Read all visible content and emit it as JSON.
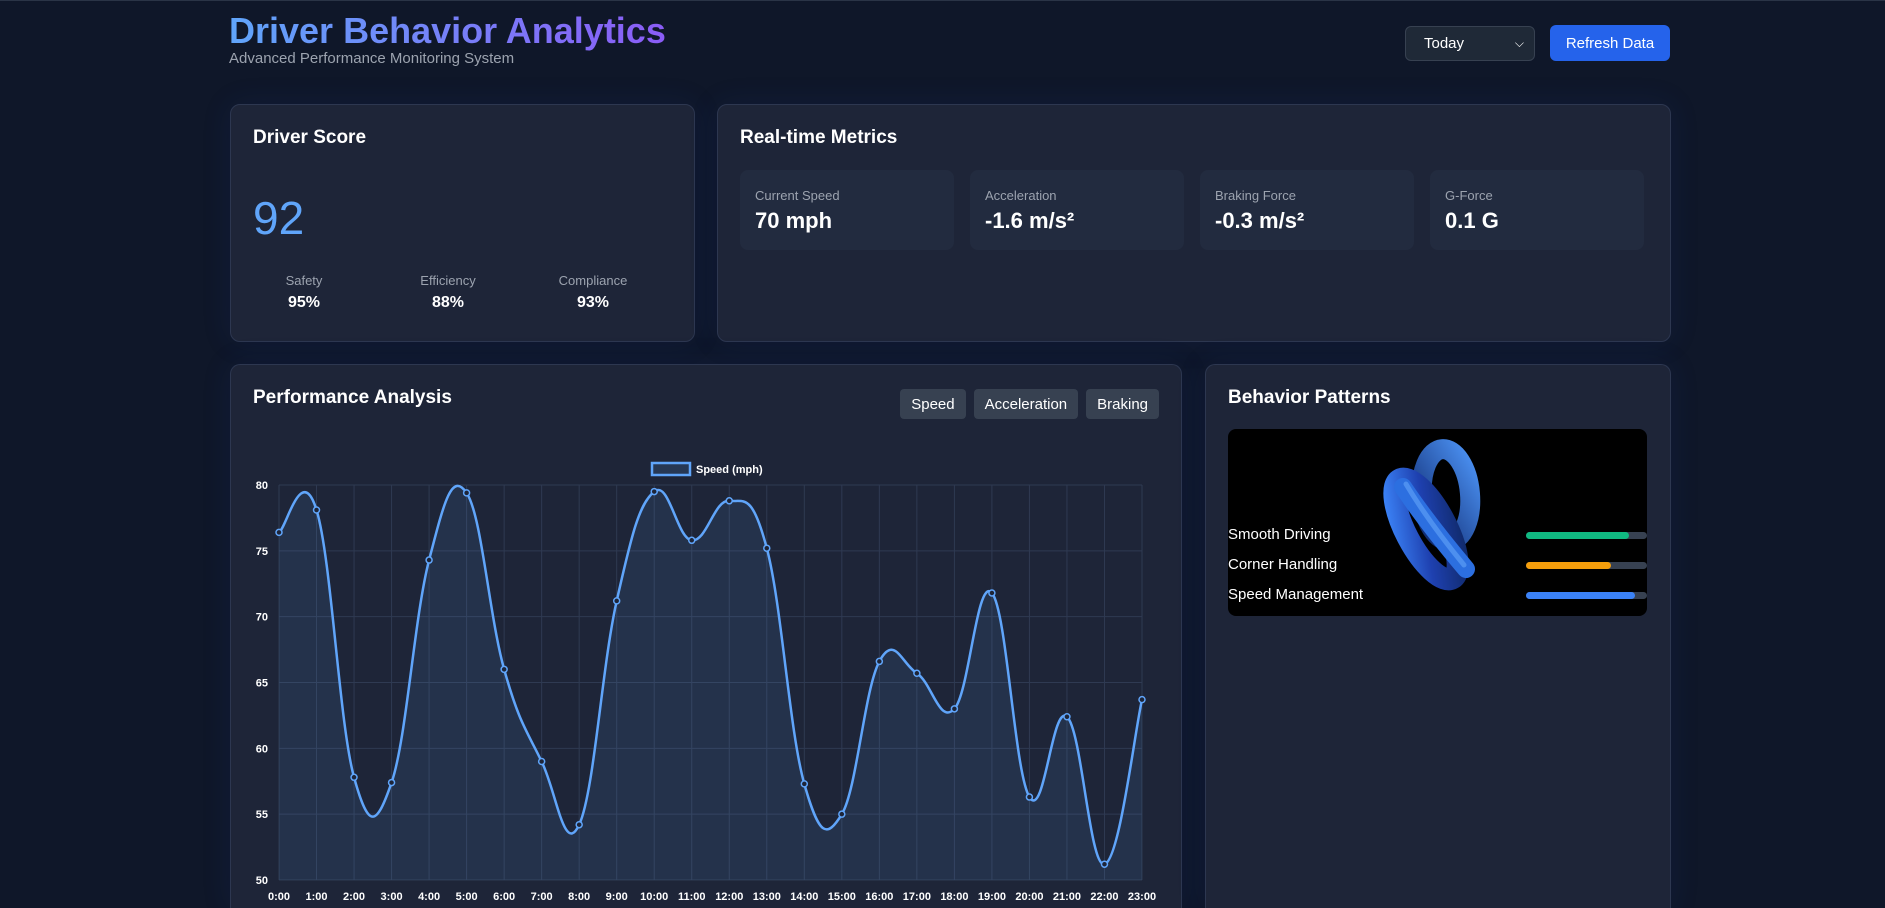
{
  "header": {
    "title": "Driver Behavior Analytics",
    "subtitle": "Advanced Performance Monitoring System",
    "period_select": "Today",
    "refresh_label": "Refresh Data"
  },
  "score_card": {
    "title": "Driver Score",
    "score": "92",
    "subs": [
      {
        "label": "Safety",
        "value": "95%"
      },
      {
        "label": "Efficiency",
        "value": "88%"
      },
      {
        "label": "Compliance",
        "value": "93%"
      }
    ]
  },
  "metrics_card": {
    "title": "Real-time Metrics",
    "metrics": [
      {
        "label": "Current Speed",
        "value": "70 mph"
      },
      {
        "label": "Acceleration",
        "value": "-1.6 m/s²"
      },
      {
        "label": "Braking Force",
        "value": "-0.3 m/s²"
      },
      {
        "label": "G-Force",
        "value": "0.1 G"
      }
    ]
  },
  "performance_card": {
    "title": "Performance Analysis",
    "tabs": [
      "Speed",
      "Acceleration",
      "Braking"
    ]
  },
  "chart_data": {
    "type": "line",
    "legend": "Speed (mph)",
    "line_color": "#60a5fa",
    "x": [
      "0:00",
      "1:00",
      "2:00",
      "3:00",
      "4:00",
      "5:00",
      "6:00",
      "7:00",
      "8:00",
      "9:00",
      "10:00",
      "11:00",
      "12:00",
      "13:00",
      "14:00",
      "15:00",
      "16:00",
      "17:00",
      "18:00",
      "19:00",
      "20:00",
      "21:00",
      "22:00",
      "23:00"
    ],
    "series": [
      {
        "name": "Speed (mph)",
        "values": [
          76.4,
          78.1,
          57.8,
          57.4,
          74.3,
          79.4,
          66.0,
          59.0,
          54.2,
          71.2,
          79.5,
          75.8,
          78.8,
          75.2,
          57.3,
          55.0,
          66.6,
          65.7,
          63.0,
          71.8,
          56.3,
          62.4,
          51.2,
          63.7
        ]
      }
    ],
    "ylim": [
      50,
      80
    ],
    "yticks": [
      50,
      55,
      60,
      65,
      70,
      75,
      80
    ],
    "grid": true,
    "legend_position": "top-center"
  },
  "behavior_card": {
    "title": "Behavior Patterns",
    "patterns": [
      {
        "label": "Smooth Driving",
        "value": 0.85,
        "color": "#10b981"
      },
      {
        "label": "Corner Handling",
        "value": 0.7,
        "color": "#f59e0b"
      },
      {
        "label": "Speed Management",
        "value": 0.9,
        "color": "#3b82f6"
      }
    ]
  }
}
